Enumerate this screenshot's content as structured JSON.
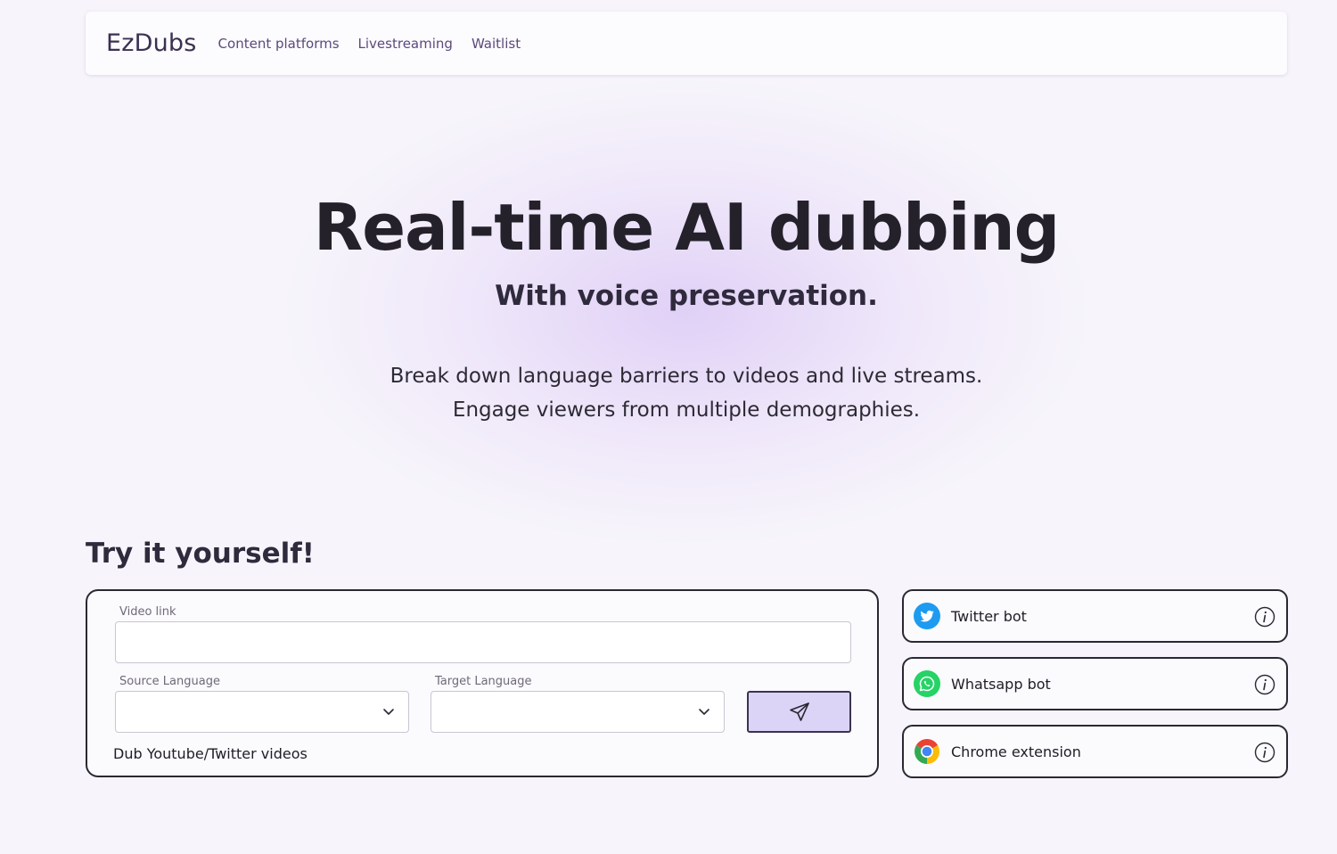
{
  "nav": {
    "brand": "EzDubs",
    "links": [
      "Content platforms",
      "Livestreaming",
      "Waitlist"
    ]
  },
  "hero": {
    "title": "Real-time AI dubbing",
    "subtitle": "With voice preservation.",
    "description": "Break down language barriers to videos and live streams. Engage viewers from multiple demographies."
  },
  "try": {
    "title": "Try it yourself!",
    "video_link_label": "Video link",
    "video_link_value": "",
    "source_label": "Source Language",
    "source_value": "",
    "target_label": "Target Language",
    "target_value": "",
    "caption": "Dub Youtube/Twitter videos",
    "send_icon": "paper-plane-icon"
  },
  "options": [
    {
      "label": "Twitter bot",
      "icon": "twitter-icon",
      "color": "#1d9bf0"
    },
    {
      "label": "Whatsapp bot",
      "icon": "whatsapp-icon",
      "color": "#25d366"
    },
    {
      "label": "Chrome extension",
      "icon": "chrome-icon",
      "color": "#4285f4"
    }
  ],
  "colors": {
    "accent": "#dcd4f7",
    "brand_text": "#3b3052",
    "nav_link": "#5b4a7a"
  }
}
